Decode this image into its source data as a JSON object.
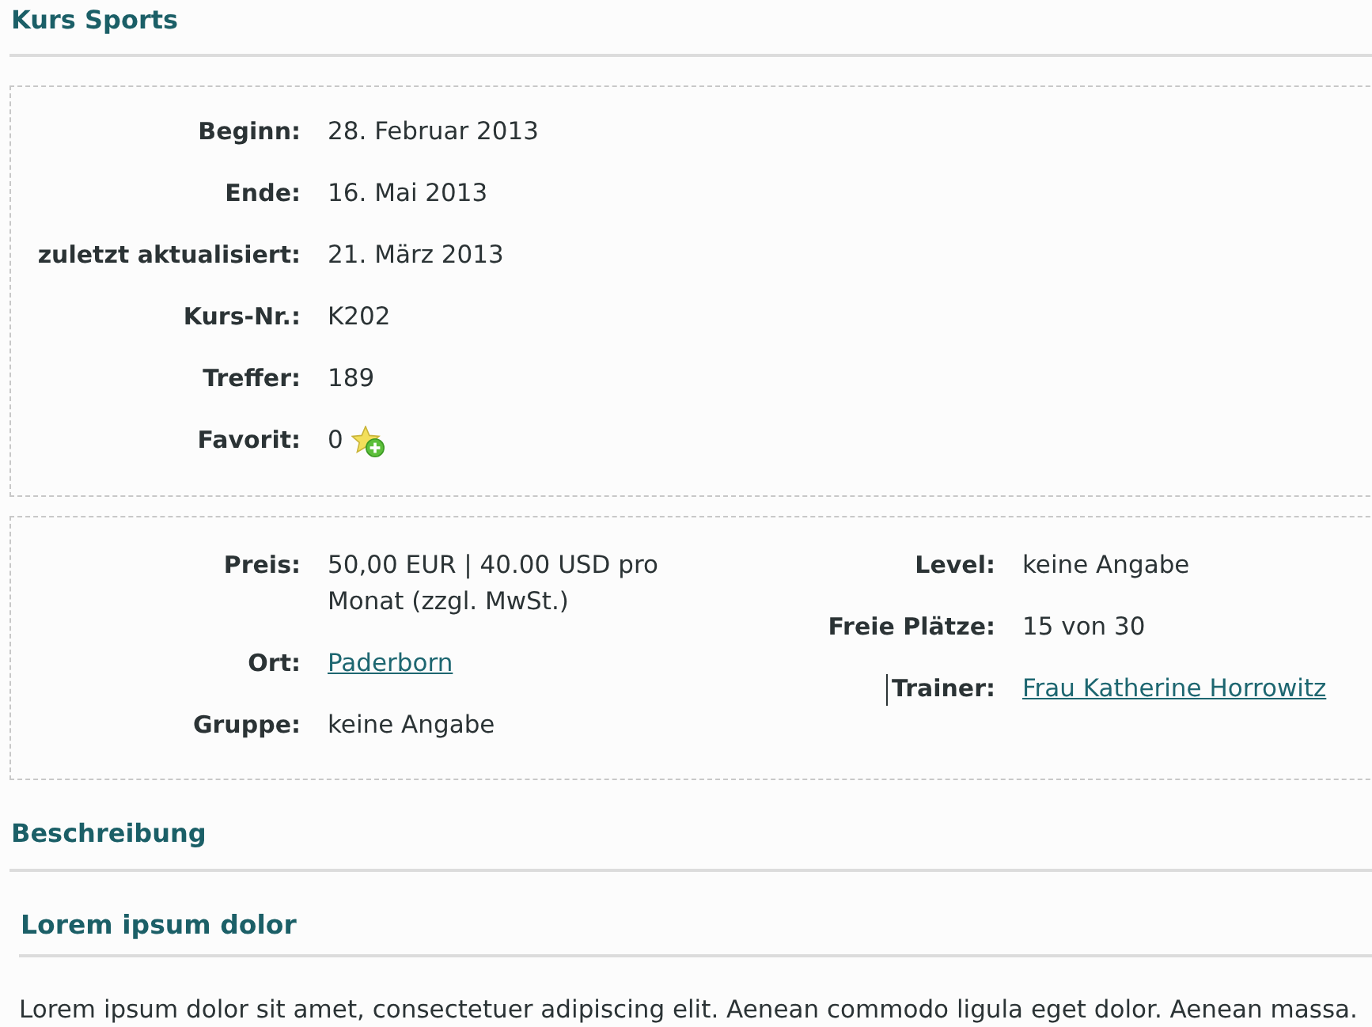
{
  "title": "Kurs Sports",
  "info": [
    {
      "kind": "text",
      "label": "Beginn:",
      "value": "28. Februar 2013"
    },
    {
      "kind": "text",
      "label": "Ende:",
      "value": "16. Mai 2013"
    },
    {
      "kind": "text",
      "label": "zuletzt aktualisiert:",
      "value": "21. März 2013"
    },
    {
      "kind": "text",
      "label": "Kurs-Nr.:",
      "value": "K202"
    },
    {
      "kind": "text",
      "label": "Treffer:",
      "value": "189"
    },
    {
      "kind": "favorite",
      "label": "Favorit:",
      "value": "0"
    }
  ],
  "details": {
    "left": [
      {
        "kind": "text",
        "label": "Preis:",
        "value": "50,00 EUR | 40.00 USD pro Monat (zzgl. MwSt.)",
        "caret": false
      },
      {
        "kind": "link",
        "label": "Ort:",
        "value": "Paderborn",
        "caret": false
      },
      {
        "kind": "text",
        "label": "Gruppe:",
        "value": "keine Angabe",
        "caret": false
      }
    ],
    "right": [
      {
        "kind": "text",
        "label": "Level:",
        "value": "keine Angabe",
        "caret": false
      },
      {
        "kind": "text",
        "label": "Freie Plätze:",
        "value": "15 von 30",
        "caret": false
      },
      {
        "kind": "link",
        "label": "Trainer:",
        "value": "Frau Katherine Horrowitz",
        "caret": true
      }
    ]
  },
  "description": {
    "heading": "Beschreibung",
    "subheading": "Lorem ipsum dolor",
    "text": "Lorem ipsum dolor sit amet, consectetuer adipiscing elit. Aenean commodo ligula eget dolor. Aenean massa."
  }
}
